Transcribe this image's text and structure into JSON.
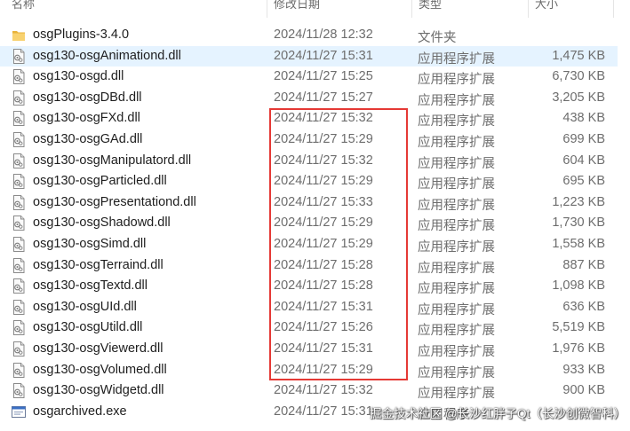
{
  "header": {
    "name_label": "名称",
    "date_label": "修改日期",
    "type_label": "类型",
    "size_label": "大小"
  },
  "files": [
    {
      "name": "osgPlugins-3.4.0",
      "date": "2024/11/28 12:32",
      "type": "文件夹",
      "size": "",
      "icon": "folder-icon"
    },
    {
      "name": "osg130-osgAnimationd.dll",
      "date": "2024/11/27 15:31",
      "type": "应用程序扩展",
      "size": "1,475 KB",
      "icon": "dll-file-icon",
      "selected": true
    },
    {
      "name": "osg130-osgd.dll",
      "date": "2024/11/27 15:25",
      "type": "应用程序扩展",
      "size": "6,730 KB",
      "icon": "dll-file-icon"
    },
    {
      "name": "osg130-osgDBd.dll",
      "date": "2024/11/27 15:27",
      "type": "应用程序扩展",
      "size": "3,205 KB",
      "icon": "dll-file-icon"
    },
    {
      "name": "osg130-osgFXd.dll",
      "date": "2024/11/27 15:32",
      "type": "应用程序扩展",
      "size": "438 KB",
      "icon": "dll-file-icon"
    },
    {
      "name": "osg130-osgGAd.dll",
      "date": "2024/11/27 15:29",
      "type": "应用程序扩展",
      "size": "699 KB",
      "icon": "dll-file-icon"
    },
    {
      "name": "osg130-osgManipulatord.dll",
      "date": "2024/11/27 15:32",
      "type": "应用程序扩展",
      "size": "604 KB",
      "icon": "dll-file-icon"
    },
    {
      "name": "osg130-osgParticled.dll",
      "date": "2024/11/27 15:29",
      "type": "应用程序扩展",
      "size": "695 KB",
      "icon": "dll-file-icon"
    },
    {
      "name": "osg130-osgPresentationd.dll",
      "date": "2024/11/27 15:33",
      "type": "应用程序扩展",
      "size": "1,223 KB",
      "icon": "dll-file-icon"
    },
    {
      "name": "osg130-osgShadowd.dll",
      "date": "2024/11/27 15:29",
      "type": "应用程序扩展",
      "size": "1,730 KB",
      "icon": "dll-file-icon"
    },
    {
      "name": "osg130-osgSimd.dll",
      "date": "2024/11/27 15:29",
      "type": "应用程序扩展",
      "size": "1,558 KB",
      "icon": "dll-file-icon"
    },
    {
      "name": "osg130-osgTerraind.dll",
      "date": "2024/11/27 15:28",
      "type": "应用程序扩展",
      "size": "887 KB",
      "icon": "dll-file-icon"
    },
    {
      "name": "osg130-osgTextd.dll",
      "date": "2024/11/27 15:28",
      "type": "应用程序扩展",
      "size": "1,098 KB",
      "icon": "dll-file-icon"
    },
    {
      "name": "osg130-osgUId.dll",
      "date": "2024/11/27 15:31",
      "type": "应用程序扩展",
      "size": "636 KB",
      "icon": "dll-file-icon"
    },
    {
      "name": "osg130-osgUtild.dll",
      "date": "2024/11/27 15:26",
      "type": "应用程序扩展",
      "size": "5,519 KB",
      "icon": "dll-file-icon"
    },
    {
      "name": "osg130-osgViewerd.dll",
      "date": "2024/11/27 15:31",
      "type": "应用程序扩展",
      "size": "1,976 KB",
      "icon": "dll-file-icon"
    },
    {
      "name": "osg130-osgVolumed.dll",
      "date": "2024/11/27 15:29",
      "type": "应用程序扩展",
      "size": "933 KB",
      "icon": "dll-file-icon"
    },
    {
      "name": "osg130-osgWidgetd.dll",
      "date": "2024/11/27 15:32",
      "type": "应用程序扩展",
      "size": "900 KB",
      "icon": "dll-file-icon"
    },
    {
      "name": "osgarchived.exe",
      "date": "2024/11/27 15:31",
      "type": "应用程序",
      "size": "",
      "icon": "exe-file-icon"
    }
  ],
  "watermark": "掘金技术社区 @长沙红胖子Qt（长沙创微智科）",
  "colors": {
    "selected_row": "#e5f3ff",
    "highlight_box": "#e53935",
    "folder": "#f4c542"
  }
}
